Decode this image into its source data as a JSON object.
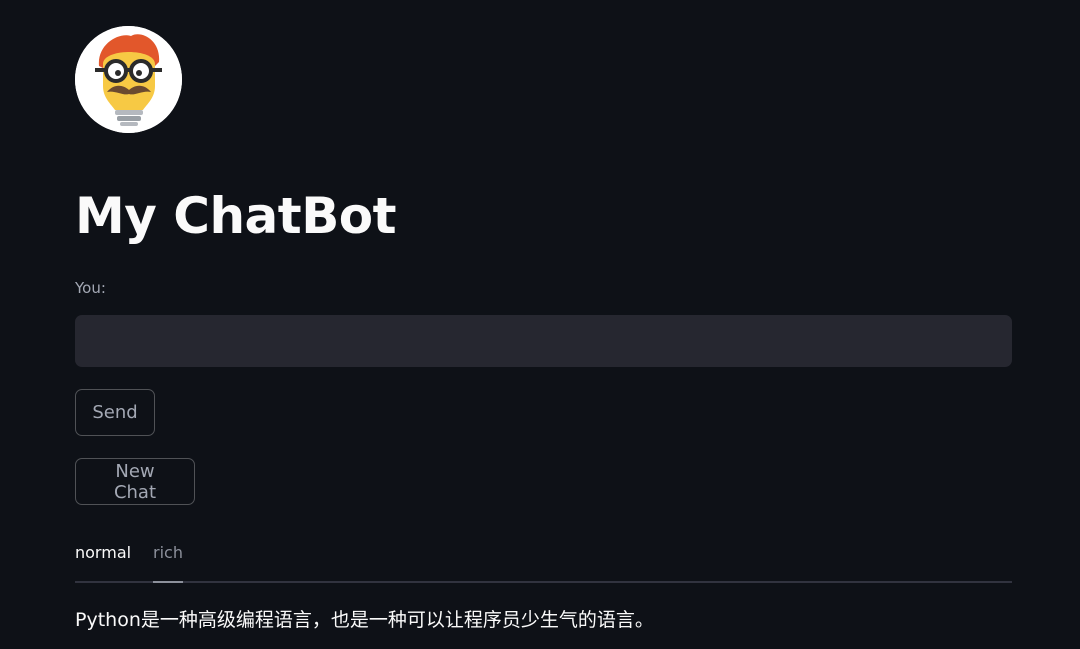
{
  "app": {
    "title": "My ChatBot"
  },
  "avatar": {
    "icon": "nerd-lightbulb-mascot-icon"
  },
  "input": {
    "label": "You:",
    "value": "",
    "placeholder": ""
  },
  "buttons": {
    "send_label": "Send",
    "new_chat_label": "New Chat"
  },
  "tabs": [
    {
      "label": "normal",
      "selected": false
    },
    {
      "label": "rich",
      "selected": true
    }
  ],
  "response": {
    "text": "Python是一种高级编程语言，也是一种可以让程序员少生气的语言。"
  },
  "colors": {
    "background": "#0e1117",
    "input_background": "#262730",
    "text": "#fafafa",
    "muted_text": "#a3a8b4",
    "tab_underline": "#31333f"
  }
}
